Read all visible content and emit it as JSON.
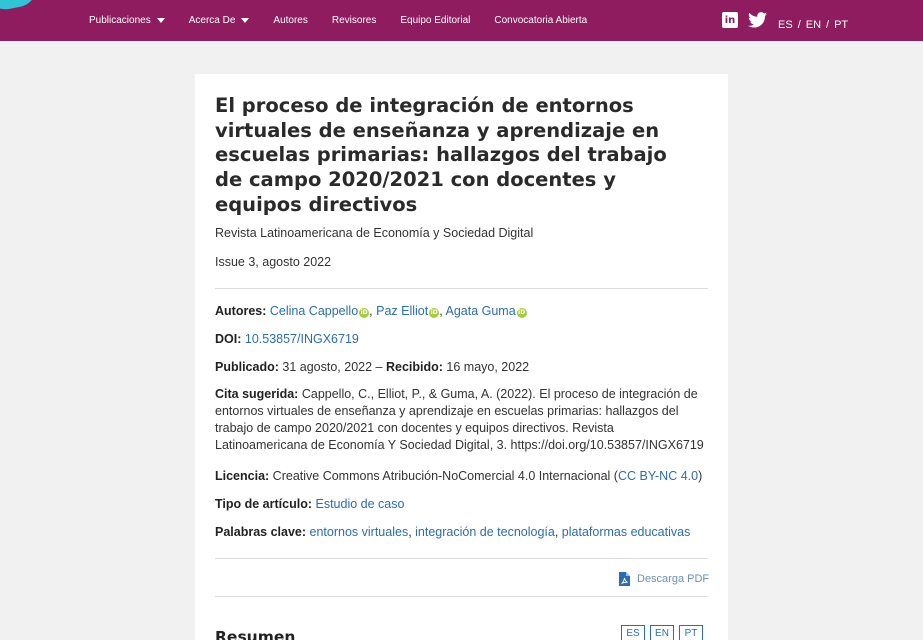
{
  "nav": {
    "items": [
      {
        "label": "Publicaciones",
        "dropdown": true
      },
      {
        "label": "Acerca De",
        "dropdown": true
      },
      {
        "label": "Autores",
        "dropdown": false
      },
      {
        "label": "Revisores",
        "dropdown": false
      },
      {
        "label": "Equipo Editorial",
        "dropdown": false
      },
      {
        "label": "Convocatoria Abierta",
        "dropdown": false
      }
    ],
    "social": {
      "linkedin": "in",
      "twitter_icon": "twitter-icon"
    },
    "langs": [
      "ES",
      "/",
      "EN",
      "/",
      "PT"
    ]
  },
  "article": {
    "title": "El proceso de integración de entornos virtuales de enseñanza y aprendizaje en escuelas primarias: hallazgos del trabajo de campo 2020/2021 con docentes y equipos directivos",
    "journal": "Revista Latinoamericana de Economía y Sociedad Digital",
    "issue": "Issue 3, agosto 2022",
    "authors_label": "Autores:",
    "authors": [
      "Celina Cappello",
      "Paz Elliot",
      "Agata Guma"
    ],
    "doi_label": "DOI:",
    "doi": "10.53857/INGX6719",
    "published_label": "Publicado:",
    "published": "31 agosto, 2022",
    "sep": "–",
    "received_label": "Recibido:",
    "received": "16 mayo, 2022",
    "citation_label": "Cita sugerida:",
    "citation": "Cappello, C., Elliot, P., & Guma, A. (2022). El proceso de integración de entornos virtuales de enseñanza y aprendizaje en escuelas primarias: hallazgos del trabajo de campo 2020/2021 con docentes y equipos directivos. Revista Latinoamericana de Economía Y Sociedad Digital, 3. https://doi.org/10.53857/INGX6719",
    "license_label": "Licencia:",
    "license_text": "Creative Commons Atribución-NoComercial 4.0 Internacional (",
    "license_link": "CC BY-NC 4.0",
    "license_close": ")",
    "type_label": "Tipo de artículo:",
    "type": "Estudio de caso",
    "keywords_label": "Palabras clave:",
    "keywords": [
      "entornos virtuales",
      "integración de tecnología",
      "plataformas educativas"
    ],
    "pdf_label": "Descarga PDF",
    "summary_heading": "Resumen",
    "summary_langs": [
      "ES",
      "EN",
      "PT"
    ]
  },
  "colors": {
    "brand": "#8e1c5f",
    "link": "#2a6db5",
    "orcid": "#a6ce39"
  }
}
